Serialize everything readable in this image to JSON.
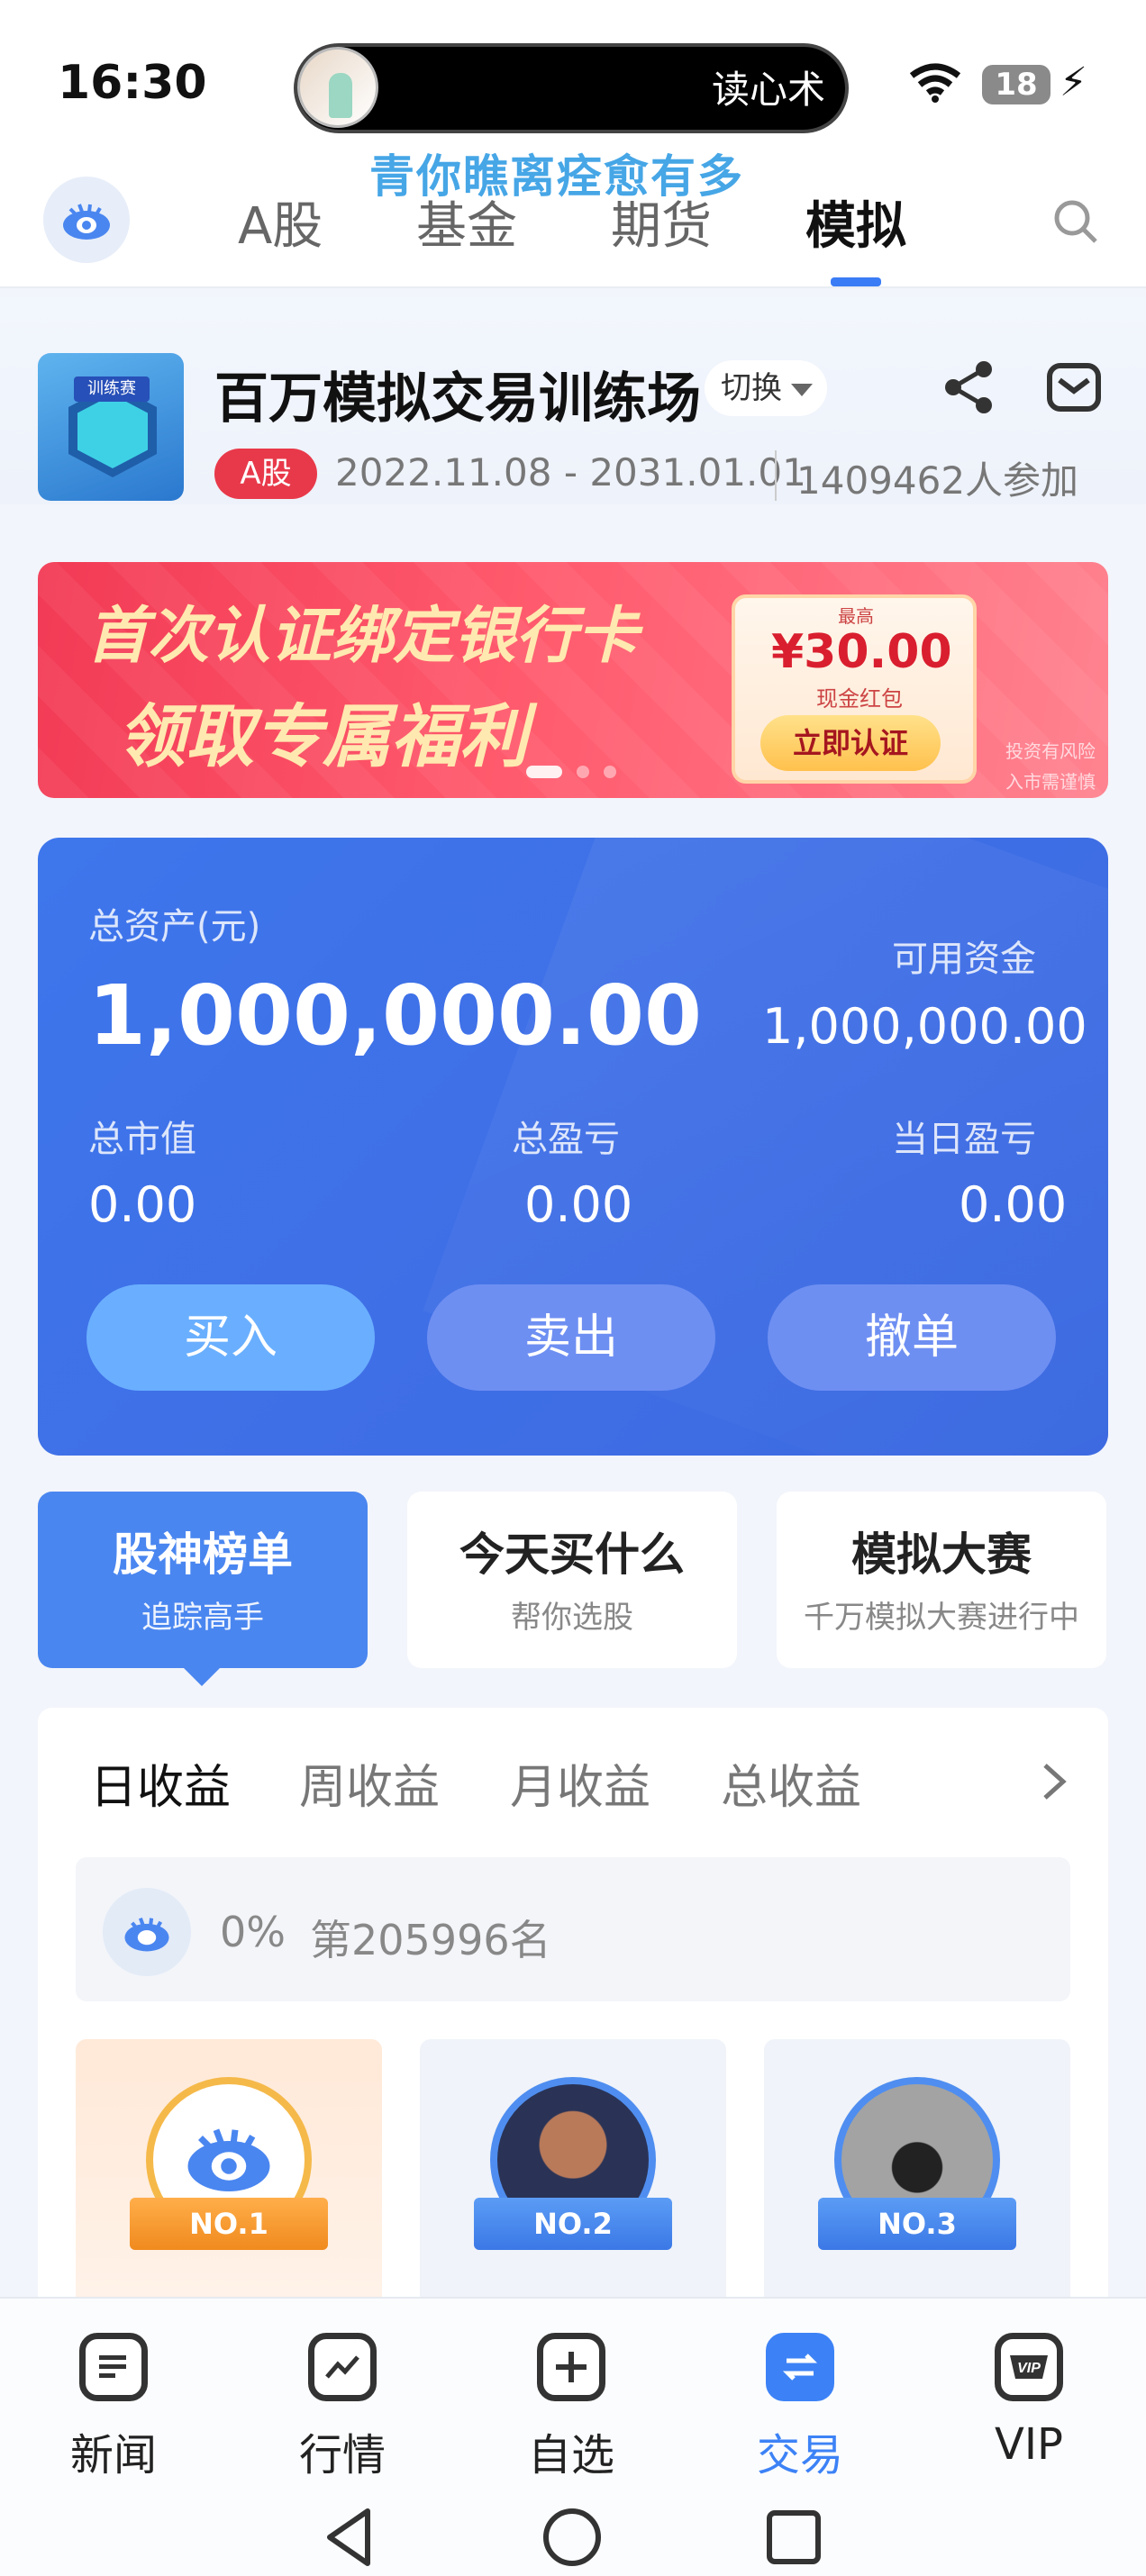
{
  "status_bar": {
    "time": "16:30",
    "island_text": "读心术",
    "battery": "18"
  },
  "marquee": "青你瞧离痊愈有多",
  "top_tabs": [
    "A股",
    "基金",
    "期货",
    "模拟"
  ],
  "active_top_tab": "模拟",
  "game": {
    "logo_text": "训练赛",
    "title": "百万模拟交易训练场",
    "switch_label": "切换",
    "market_badge": "A股",
    "date_range": "2022.11.08 - 2031.01.01",
    "participants": "1409462人参加"
  },
  "banner": {
    "line1": "首次认证绑定银行卡",
    "line2": "领取专属福利",
    "coupon_top": "最高",
    "coupon_amount": "¥30.00",
    "coupon_sub": "现金红包",
    "coupon_button": "立即认证",
    "risk1": "投资有风险",
    "risk2": "入市需谨慎",
    "active_slide": 1,
    "slide_count": 3
  },
  "assets": {
    "total_label": "总资产(元)",
    "total_value": "1,000,000.00",
    "available_label": "可用资金",
    "available_value": "1,000,000.00",
    "market_value_label": "总市值",
    "market_value": "0.00",
    "pnl_label": "总盈亏",
    "pnl_value": "0.00",
    "day_pnl_label": "当日盈亏",
    "day_pnl_value": "0.00",
    "buy": "买入",
    "sell": "卖出",
    "cancel": "撤单"
  },
  "quick_cards": [
    {
      "title": "股神榜单",
      "sub": "追踪高手"
    },
    {
      "title": "今天买什么",
      "sub": "帮你选股"
    },
    {
      "title": "模拟大赛",
      "sub": "千万模拟大赛进行中"
    }
  ],
  "rank_tabs": [
    "日收益",
    "周收益",
    "月收益",
    "总收益"
  ],
  "active_rank_tab": "日收益",
  "my_rank": {
    "percent": "0%",
    "rank": "第205996名"
  },
  "podium": [
    "NO.1",
    "NO.2",
    "NO.3"
  ],
  "bottom_nav": [
    "新闻",
    "行情",
    "自选",
    "交易",
    "VIP"
  ],
  "active_bottom_nav": "交易",
  "colors": {
    "accent": "#3c82f6",
    "asset_card": "#3f6fe6",
    "badge_red": "#e8394a",
    "banner": "#f23a55"
  }
}
